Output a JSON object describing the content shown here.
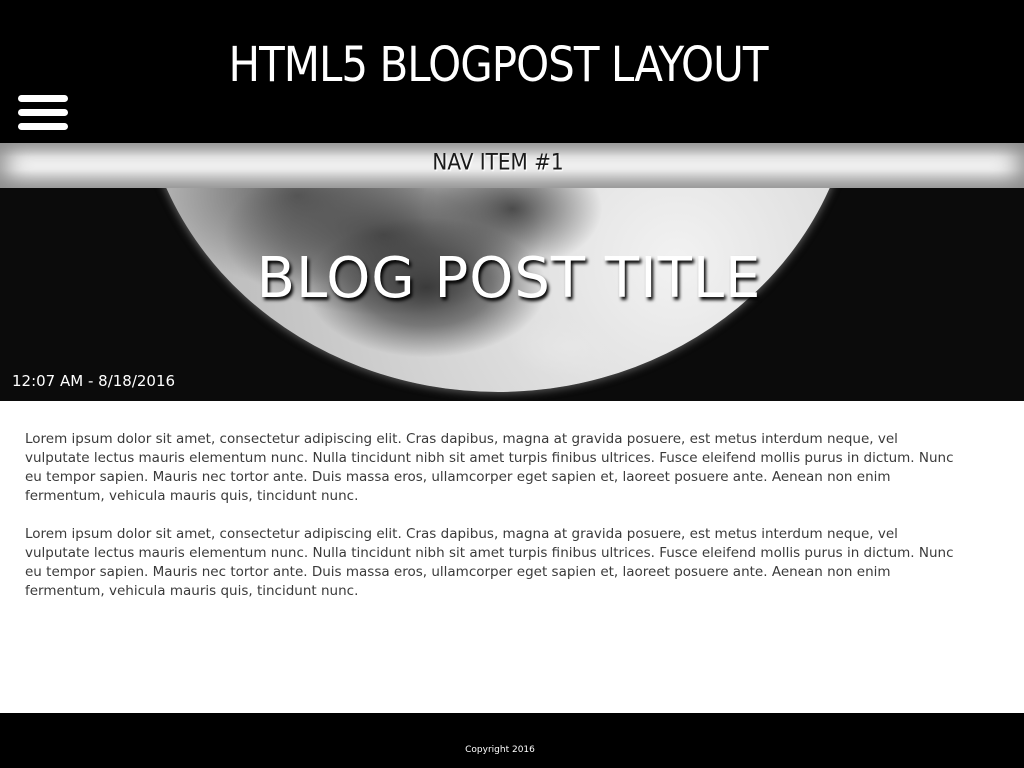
{
  "header": {
    "site_title": "HTML5 BLOGPOST LAYOUT",
    "menu_icon": "hamburger-menu-icon"
  },
  "nav": {
    "items": [
      {
        "label": "NAV ITEM #1"
      }
    ]
  },
  "hero": {
    "image": "moon-photo",
    "post_title": "BLOG POST TITLE",
    "timestamp": "12:07 AM - 8/18/2016"
  },
  "article": {
    "paragraphs": [
      "Lorem ipsum dolor sit amet, consectetur adipiscing elit. Cras dapibus, magna at gravida posuere, est metus interdum neque, vel vulputate lectus mauris elementum nunc. Nulla tincidunt nibh sit amet turpis finibus ultrices. Fusce eleifend mollis purus in dictum. Nunc eu tempor sapien. Mauris nec tortor ante. Duis massa eros, ullamcorper eget sapien et, laoreet posuere ante. Aenean non enim fermentum, vehicula mauris quis, tincidunt nunc.",
      "Lorem ipsum dolor sit amet, consectetur adipiscing elit. Cras dapibus, magna at gravida posuere, est metus interdum neque, vel vulputate lectus mauris elementum nunc. Nulla tincidunt nibh sit amet turpis finibus ultrices. Fusce eleifend mollis purus in dictum. Nunc eu tempor sapien. Mauris nec tortor ante. Duis massa eros, ullamcorper eget sapien et, laoreet posuere ante. Aenean non enim fermentum, vehicula mauris quis, tincidunt nunc."
    ]
  },
  "footer": {
    "copyright": "Copyright 2016"
  },
  "colors": {
    "header_bg": "#000000",
    "footer_bg": "#000000",
    "page_bg": "#ffffff",
    "body_text": "#3a3a3a",
    "nav_text": "#1a1a1a"
  }
}
